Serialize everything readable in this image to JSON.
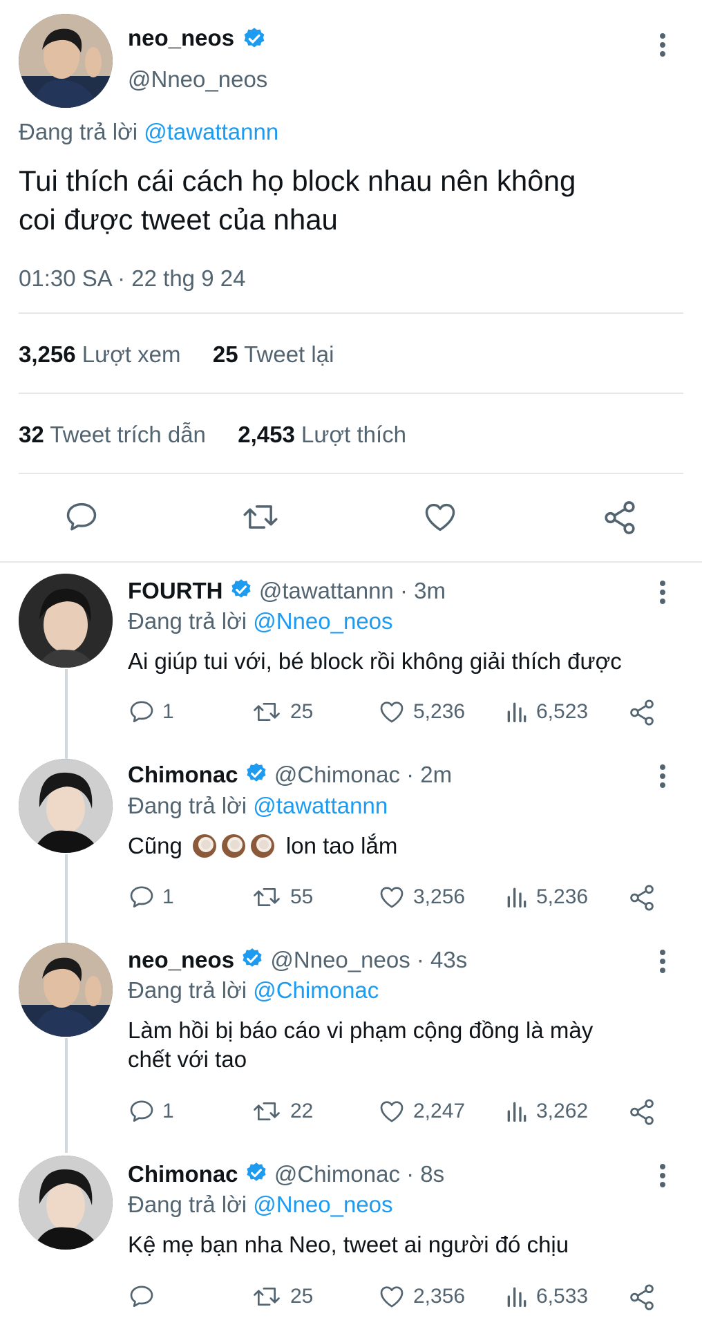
{
  "colors": {
    "accent": "#1d9bf0",
    "text": "#0f1419",
    "secondary": "#536471",
    "divider": "#e7e7e7"
  },
  "main_tweet": {
    "display_name": "neo_neos",
    "handle": "@Nneo_neos",
    "replying_prefix": "Đang trả lời",
    "replying_to": "@tawattannn",
    "text_line1": "Tui thích cái cách họ block nhau nên không",
    "text_line2": "coi được tweet của nhau",
    "timestamp": "01:30 SA · 22 thg 9 24",
    "views_count": "3,256",
    "views_label": "Lượt xem",
    "retweets_count": "25",
    "retweets_label": "Tweet lại",
    "quotes_count": "32",
    "quotes_label": "Tweet trích dẫn",
    "likes_count": "2,453",
    "likes_label": "Lượt thích",
    "icons": [
      "reply-icon",
      "retweet-icon",
      "like-icon",
      "share-icon"
    ]
  },
  "replies": [
    {
      "display_name": "FOURTH",
      "handle_time": "@tawattannn · 3m",
      "replying_prefix": "Đang trả lời",
      "replying_to": "@Nneo_neos",
      "text_line1": "Ai giúp tui với, bé block rồi không giải thích được",
      "text_line2": "",
      "replies": "1",
      "retweets": "25",
      "likes": "5,236",
      "views": "6,523"
    },
    {
      "display_name": "Chimonac",
      "handle_time": "@Chimonac · 2m",
      "replying_prefix": "Đang trả lời",
      "replying_to": "@tawattannn",
      "text_before_emoji": "Cũng",
      "text_after_emoji": "lon tao lắm",
      "emoji": "coconut",
      "replies": "1",
      "retweets": "55",
      "likes": "3,256",
      "views": "5,236"
    },
    {
      "display_name": "neo_neos",
      "handle_time": "@Nneo_neos · 43s",
      "replying_prefix": "Đang trả lời",
      "replying_to": "@Chimonac",
      "text_line1": "Làm hồi bị báo cáo vi phạm cộng đồng là mày",
      "text_line2": "chết với tao",
      "replies": "1",
      "retweets": "22",
      "likes": "2,247",
      "views": "3,262"
    },
    {
      "display_name": "Chimonac",
      "handle_time": "@Chimonac · 8s",
      "replying_prefix": "Đang trả lời",
      "replying_to": "@Nneo_neos",
      "text_line1": "Kệ mẹ bạn nha Neo, tweet ai người đó chịu",
      "text_line2": "",
      "replies": "",
      "retweets": "25",
      "likes": "2,356",
      "views": "6,533"
    }
  ]
}
